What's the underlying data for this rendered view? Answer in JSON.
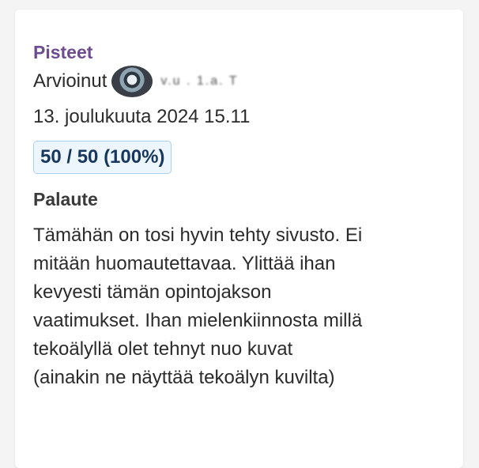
{
  "grading": {
    "heading": "Pisteet",
    "grader_label": "Arvioinut",
    "grader_name": "v.u   . 1.a. T",
    "date": "13. joulukuuta 2024 15.11",
    "score": "50 / 50 (100%)"
  },
  "feedback": {
    "heading": "Palaute",
    "lines": [
      "Tämähän on tosi hyvin tehty sivusto. Ei",
      "mitään huomautettavaa. Ylittää ihan",
      "kevyesti tämän opintojakson",
      "vaatimukset. Ihan mielenkiinnosta millä",
      "tekoälyllä olet tehnyt nuo kuvat",
      "(ainakin ne näyttää tekoälyn kuvilta)"
    ]
  },
  "colors": {
    "heading": "#6d4c8f",
    "badge_bg": "#eef6fd",
    "badge_border": "#a9d1f2",
    "badge_text": "#17375e"
  }
}
